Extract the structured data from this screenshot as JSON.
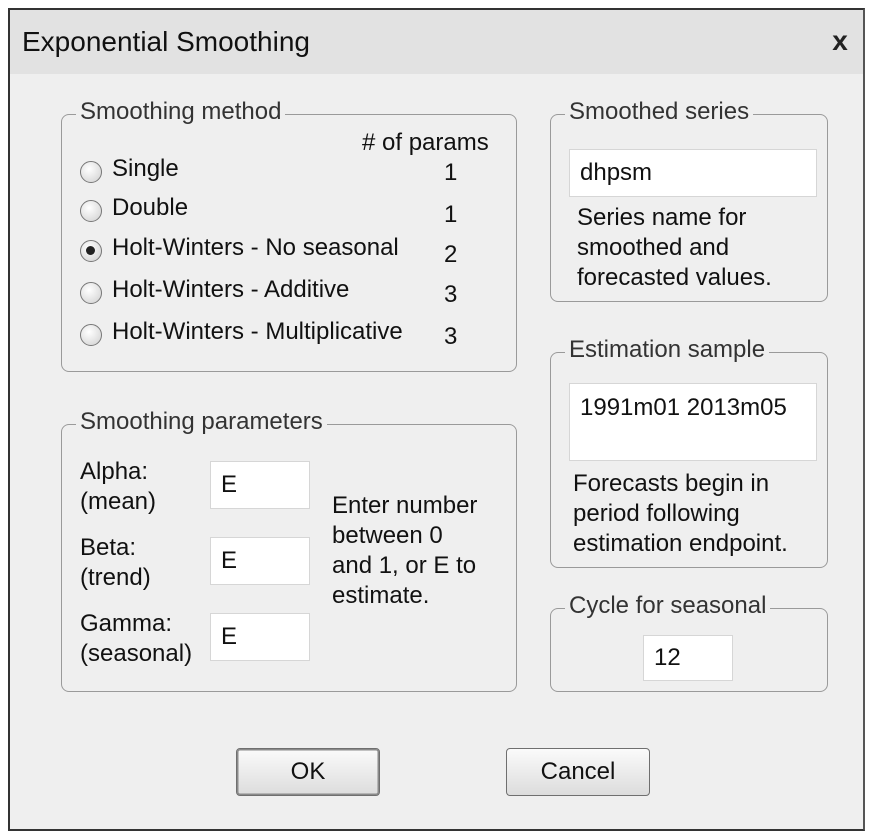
{
  "window": {
    "title": "Exponential Smoothing",
    "close_label": "x"
  },
  "smoothing_method": {
    "legend": "Smoothing method",
    "params_header": "# of params",
    "options": [
      {
        "label": "Single",
        "params": "1",
        "selected": false
      },
      {
        "label": "Double",
        "params": "1",
        "selected": false
      },
      {
        "label": "Holt-Winters - No seasonal",
        "params": "2",
        "selected": true
      },
      {
        "label": "Holt-Winters - Additive",
        "params": "3",
        "selected": false
      },
      {
        "label": "Holt-Winters - Multiplicative",
        "params": "3",
        "selected": false
      }
    ]
  },
  "smoothing_parameters": {
    "legend": "Smoothing parameters",
    "alpha_label": "Alpha:",
    "alpha_sub": "(mean)",
    "alpha_value": "E",
    "beta_label": "Beta:",
    "beta_sub": "(trend)",
    "beta_value": "E",
    "gamma_label": "Gamma:",
    "gamma_sub": "(seasonal)",
    "gamma_value": "E",
    "help_line1": "Enter number",
    "help_line2": "between  0",
    "help_line3": "and 1, or E to",
    "help_line4": "estimate."
  },
  "smoothed_series": {
    "legend": "Smoothed series",
    "value": "dhpsm",
    "help_line1": "Series name for",
    "help_line2": "smoothed and",
    "help_line3": "forecasted values."
  },
  "estimation_sample": {
    "legend": "Estimation sample",
    "value": "1991m01 2013m05",
    "help_line1": "Forecasts begin in",
    "help_line2": "period following",
    "help_line3": "estimation endpoint."
  },
  "cycle": {
    "legend": "Cycle for seasonal",
    "value": "12"
  },
  "buttons": {
    "ok": "OK",
    "cancel": "Cancel"
  }
}
